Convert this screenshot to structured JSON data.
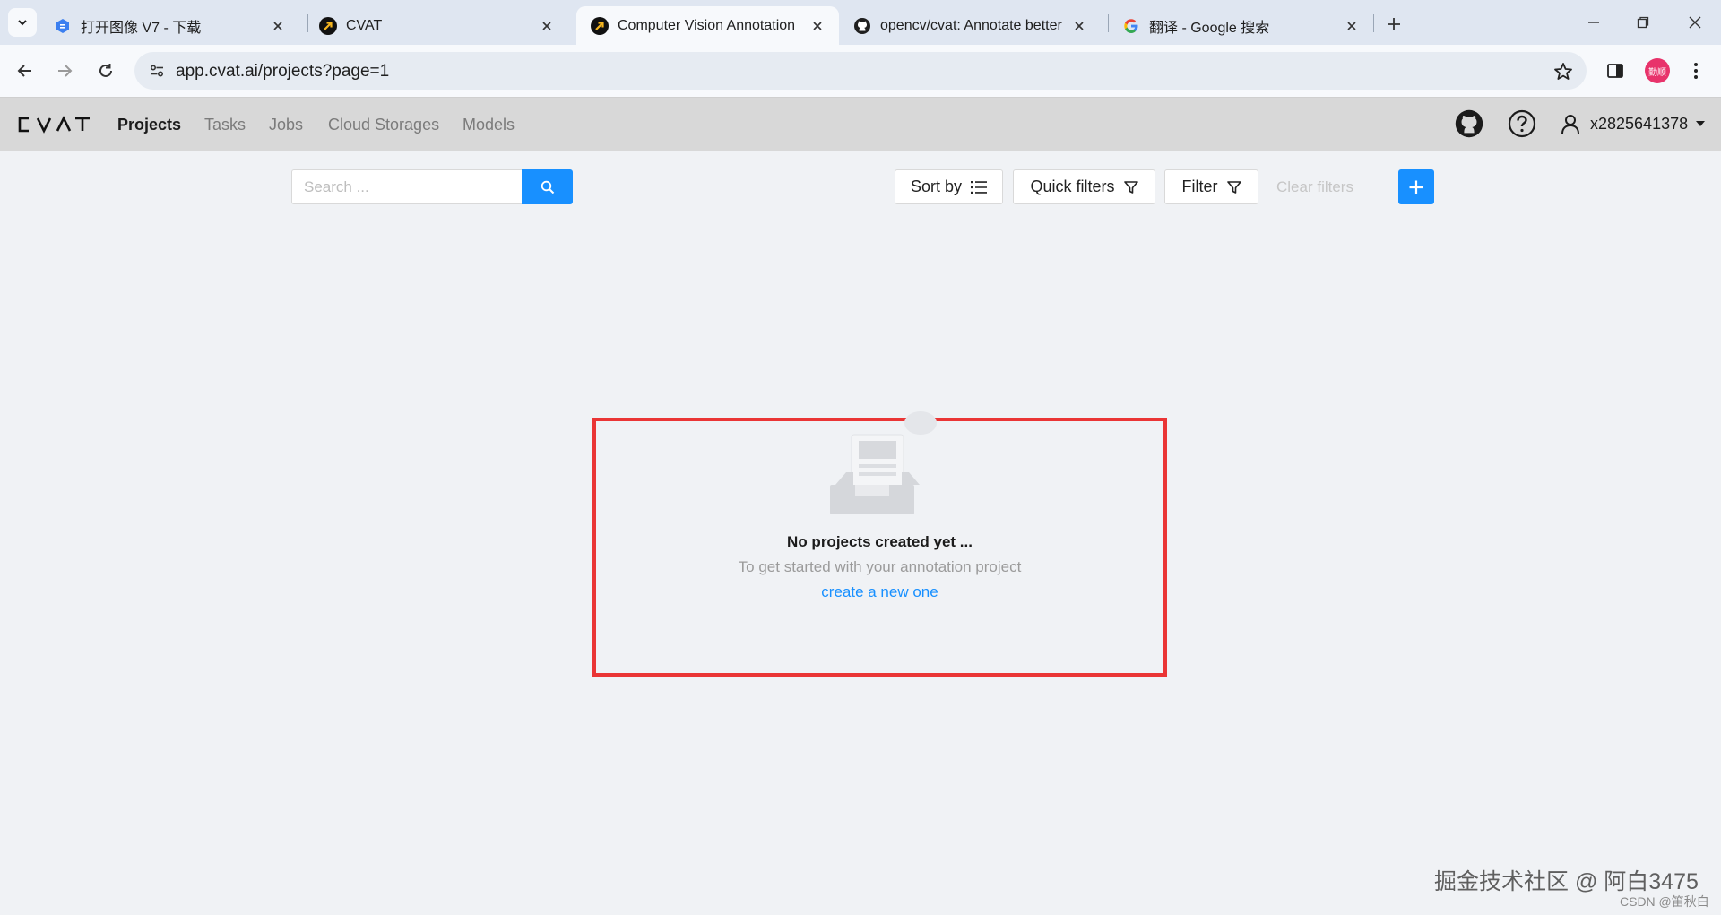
{
  "browser": {
    "tabs": [
      {
        "title": "打开图像 V7 - 下载",
        "icon": "blue-hexagon-favicon",
        "active": false
      },
      {
        "title": "CVAT",
        "icon": "cvat-favicon",
        "active": false
      },
      {
        "title": "Computer Vision Annotation",
        "icon": "cvat-favicon",
        "active": true
      },
      {
        "title": "opencv/cvat: Annotate better",
        "icon": "github-favicon",
        "active": false
      },
      {
        "title": "翻译 - Google 搜索",
        "icon": "google-favicon",
        "active": false
      }
    ],
    "url": "app.cvat.ai/projects?page=1",
    "profile_badge": "勤顺",
    "accent_color": "#1890ff"
  },
  "app": {
    "logo": "CVAT",
    "nav": [
      "Projects",
      "Tasks",
      "Jobs",
      "Cloud Storages",
      "Models"
    ],
    "active_nav": "Projects",
    "username": "x2825641378"
  },
  "controls": {
    "search_placeholder": "Search ...",
    "sort_by": "Sort by",
    "quick_filters": "Quick filters",
    "filter": "Filter",
    "clear_filters": "Clear filters"
  },
  "empty_state": {
    "title": "No projects created yet ...",
    "description": "To get started with your annotation project",
    "link": "create a new one",
    "highlight_color": "#ea3535"
  },
  "watermark": {
    "main": "掘金技术社区 @ 阿白3475",
    "sub": "CSDN @笛秋白"
  }
}
